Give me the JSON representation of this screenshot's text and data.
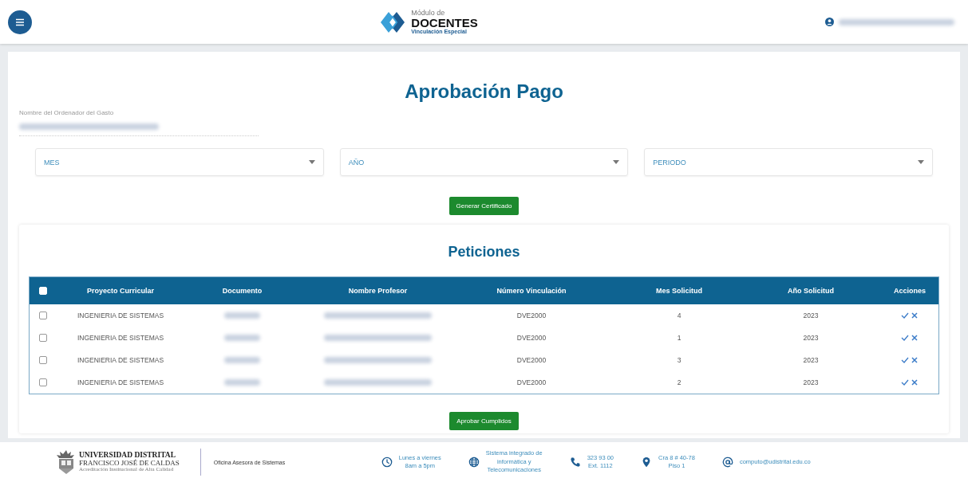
{
  "header": {
    "logo": {
      "small": "Módulo de",
      "big": "DOCENTES",
      "sub": "Vinculación Especial"
    }
  },
  "page": {
    "title": "Aprobación Pago",
    "ordenador_label": "Nombre del Ordenador del Gasto",
    "selects": [
      {
        "placeholder": "MES"
      },
      {
        "placeholder": "AÑO"
      },
      {
        "placeholder": "PERIODO"
      }
    ],
    "generate_button": "Generar Certificado"
  },
  "peticiones": {
    "title": "Peticiones",
    "select_all": {
      "checked": false
    },
    "columns": [
      "Proyecto Curricular",
      "Documento",
      "Nombre Profesor",
      "Número Vinculación",
      "Mes Solicitud",
      "Año Solicitud",
      "Acciones"
    ],
    "rows": [
      {
        "checked": false,
        "proyecto": "INGENIERIA DE SISTEMAS",
        "numero": "DVE2000",
        "mes": "4",
        "anio": "2023"
      },
      {
        "checked": false,
        "proyecto": "INGENIERIA DE SISTEMAS",
        "numero": "DVE2000",
        "mes": "1",
        "anio": "2023"
      },
      {
        "checked": false,
        "proyecto": "INGENIERIA DE SISTEMAS",
        "numero": "DVE2000",
        "mes": "3",
        "anio": "2023"
      },
      {
        "checked": false,
        "proyecto": "INGENIERIA DE SISTEMAS",
        "numero": "DVE2000",
        "mes": "2",
        "anio": "2023"
      }
    ],
    "approve_button": "Aprobar Cumplidos"
  },
  "footer": {
    "university": [
      "UNIVERSIDAD DISTRITAL",
      "FRANCISCO JOSÉ DE CALDAS",
      "Acreditación Institucional de Alta Calidad"
    ],
    "office": "Oficina Asesora de Sistemas",
    "items": [
      {
        "kind": "clock",
        "text": "Lunes a viernes\n8am a 5pm"
      },
      {
        "kind": "globe",
        "text": "Sistema integrado de\ninformática y\nTelecomunicaciones"
      },
      {
        "kind": "phone",
        "text": "323 93 00\nExt. 1112"
      },
      {
        "kind": "pin",
        "text": "Cra 8 # 40-78\nPiso 1"
      },
      {
        "kind": "at",
        "text": "computo@udistrital.edu.co"
      }
    ]
  }
}
